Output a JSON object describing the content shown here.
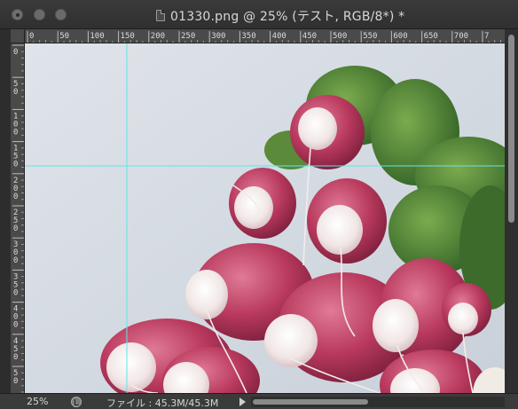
{
  "window": {
    "title": "01330.png @ 25% (テスト, RGB/8*) *",
    "buttons": [
      "close",
      "minimize",
      "zoom"
    ]
  },
  "rulers": {
    "horizontal_labels": [
      "0",
      "50",
      "100",
      "150",
      "200",
      "250",
      "300",
      "350",
      "400",
      "450",
      "500",
      "550",
      "600",
      "650",
      "700",
      "7"
    ],
    "vertical_labels": [
      "0",
      "5 0",
      "1 0 0",
      "1 5 0",
      "2 0 0",
      "2 5 0",
      "3 0 0",
      "3 5 0",
      "4 0 0",
      "4 5 0",
      "5 0"
    ]
  },
  "guides": {
    "color": "#5fe6e6",
    "vertical_at_ruler_value": 150,
    "horizontal_at_ruler_value": 180
  },
  "canvas": {
    "subject": "radishes",
    "background_color": "#d9dee5"
  },
  "status": {
    "zoom": "25%",
    "file_info": "ファイル : 45.3M/45.3M"
  },
  "icons": {
    "doc": "document-icon",
    "status": "status-info-icon",
    "arrow": "expand-arrow-icon"
  }
}
